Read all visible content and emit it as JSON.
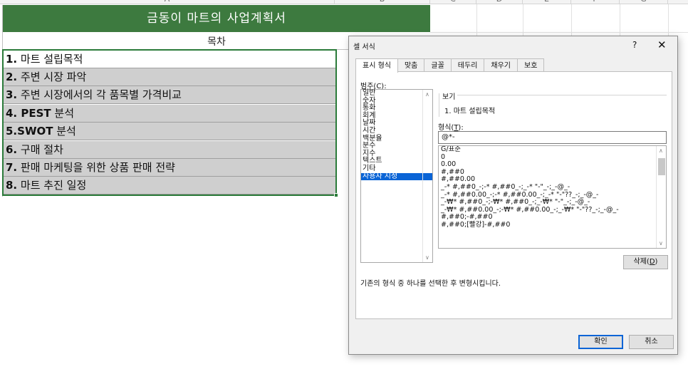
{
  "sheet": {
    "column_headers": [
      "A",
      "B",
      "C",
      "D",
      "E",
      "F",
      "G"
    ],
    "title": "금동이 마트의 사업계획서",
    "toc_label": "목차",
    "rows": [
      {
        "num": "1.",
        "text": " 마트 설립목적"
      },
      {
        "num": "2.",
        "text": " 주변 시장 파악"
      },
      {
        "num": "3.",
        "text": " 주변 시장에서의 각 품목별 가격비교"
      },
      {
        "num": "4. PEST",
        "text": " 분석"
      },
      {
        "num": "5.SWOT",
        "text": " 분석"
      },
      {
        "num": "6.",
        "text": " 구매 절차"
      },
      {
        "num": "7.",
        "text": " 판매 마케팅을 위한 상품 판매 전략"
      },
      {
        "num": "8.",
        "text": " 마트 추진 일정"
      }
    ],
    "title_bg": "#3d7a3f",
    "row_bg": "#cfcfcf",
    "selection_color": "#2b7b3a"
  },
  "dialog": {
    "title": "셀 서식",
    "help": "?",
    "close_icon": "close-icon",
    "close": "✕",
    "tabs": [
      {
        "label": "표시 형식",
        "active": true
      },
      {
        "label": "맞춤"
      },
      {
        "label": "글꼴"
      },
      {
        "label": "테두리"
      },
      {
        "label": "채우기"
      },
      {
        "label": "보호"
      }
    ],
    "category_label_prefix": "범주(",
    "category_label_key": "C",
    "category_label_suffix": "):",
    "categories": [
      "일반",
      "숫자",
      "통화",
      "회계",
      "날짜",
      "시간",
      "백분율",
      "분수",
      "지수",
      "텍스트",
      "기타",
      "사용자 지정"
    ],
    "selected_category": "사용자 지정",
    "preview_label": "보기",
    "preview_value": "1. 마트 설립목적",
    "format_label_prefix": "형식(",
    "format_label_key": "T",
    "format_label_suffix": "):",
    "format_input_value": "@*-",
    "formats": [
      "G/표준",
      "0",
      "0.00",
      "#,##0",
      "#,##0.00",
      "_-* #,##0_-;-* #,##0_-;_-* \"-\"_-;_-@_-",
      "_-* #,##0.00_-;-* #,##0.00_-;_-* \"-\"??_-;_-@_-",
      "_-₩* #,##0_-;-₩* #,##0_-;_-₩* \"-\"_-;_-@_-",
      "_-₩* #,##0.00_-;-₩* #,##0.00_-;_-₩* \"-\"??_-;_-@_-",
      "#,##0;-#,##0",
      "#,##0;[빨강]-#,##0"
    ],
    "delete_label_prefix": "삭제(",
    "delete_label_key": "D",
    "delete_label_suffix": ")",
    "hint": "기존의 형식 중 하나를 선택한 후 변형시킵니다.",
    "ok_label": "확인",
    "cancel_label": "취소",
    "accent": "#0a64d6"
  }
}
